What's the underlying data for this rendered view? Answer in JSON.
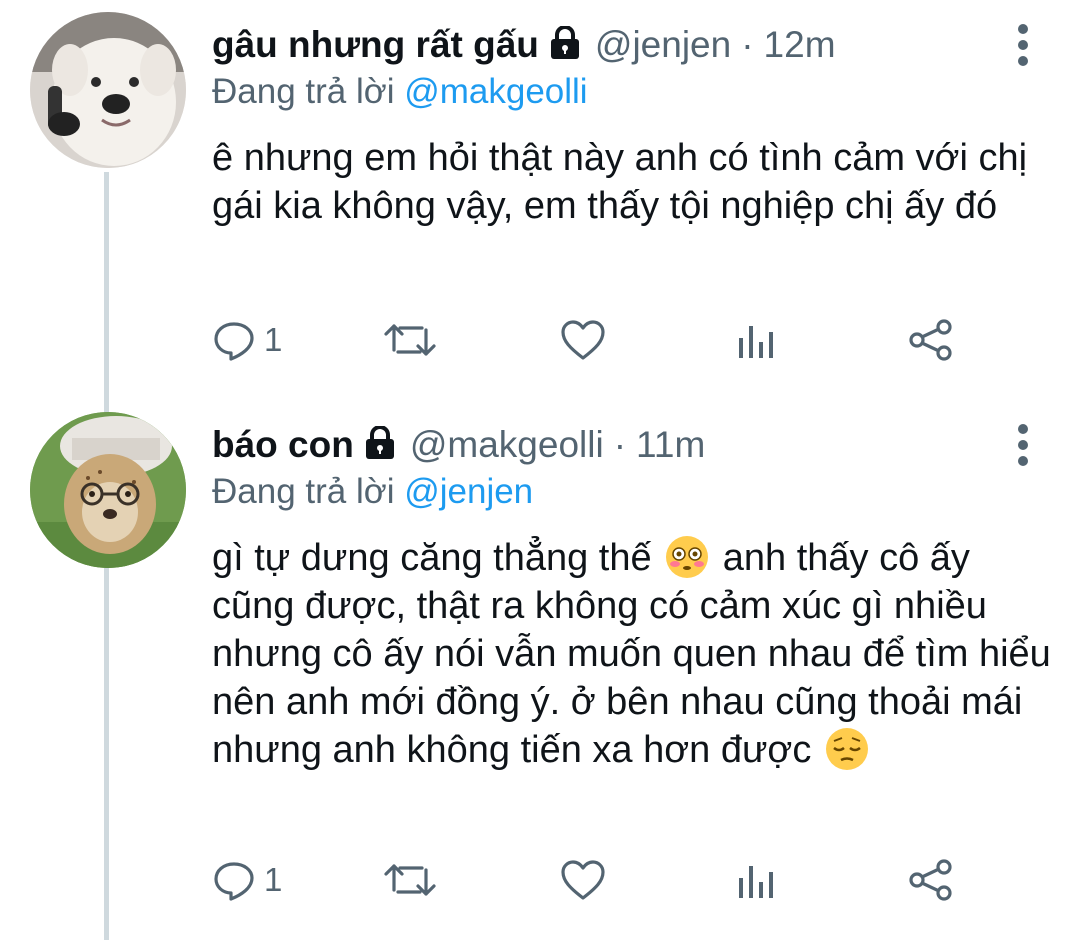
{
  "colors": {
    "text": "#0f1419",
    "secondary": "#536471",
    "link": "#1d9bf0",
    "thread_line": "#cfd9de"
  },
  "tweets": [
    {
      "name": "gâu nhưng rất gấu",
      "protected_icon": "lock-icon",
      "handle": "@jenjen",
      "separator": "·",
      "time": "12m",
      "replying_prefix": "Đang trả lời",
      "replying_to": "@makgeolli",
      "text": "ê nhưng em hỏi thật này anh có tình cảm với chị gái kia không vậy, em thấy tội nghiệp chị ấy đó",
      "avatar": "dog-avatar",
      "actions": {
        "reply_count": "1",
        "retweet_count": "",
        "like_count": ""
      }
    },
    {
      "name": "báo con",
      "protected_icon": "lock-icon",
      "handle": "@makgeolli",
      "separator": "·",
      "time": "11m",
      "replying_prefix": "Đang trả lời",
      "replying_to": "@jenjen",
      "text_part1": "gì tự dưng căng thẳng thế",
      "emoji1": "flushed-face",
      "text_part2": "anh thấy cô ấy cũng được, thật ra không có cảm xúc gì nhiều nhưng cô ấy nói vẫn muốn quen nhau để tìm hiểu nên anh mới đồng ý. ở bên nhau cũng thoải mái nhưng anh không tiến xa hơn được",
      "emoji2": "pensive-face",
      "avatar": "cheetah-cub-avatar",
      "actions": {
        "reply_count": "1",
        "retweet_count": "",
        "like_count": ""
      }
    }
  ]
}
